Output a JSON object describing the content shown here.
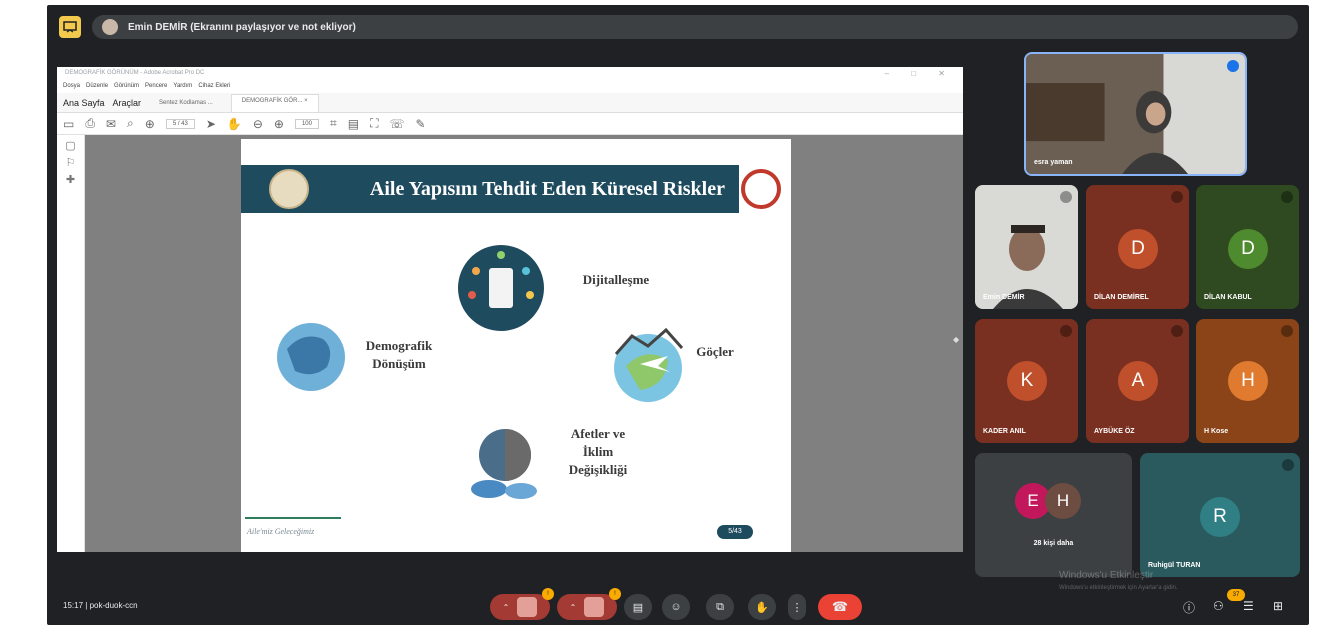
{
  "banner": {
    "presenter_text": "Emin DEMİR (Ekranını paylaşıyor ve not ekliyor)"
  },
  "pdf": {
    "titlebar": "DEMOGRAFİK GÖRÜNÜM - Adobe Acrobat Pro DC",
    "menu": [
      "Dosya",
      "Düzenle",
      "Görünüm",
      "Pencere",
      "Yardım",
      "Cihaz Ekleri"
    ],
    "nav_home": "Ana Sayfa",
    "nav_tools": "Araçlar",
    "tabs": [
      "Sentez Kodlamas ...",
      "DEMOGRAFİK GÖR... ×"
    ],
    "page_box": "5 / 43",
    "zoom": "100"
  },
  "slide": {
    "title": "Aile Yapısını Tehdit Eden Küresel Riskler",
    "items": {
      "dijital": "Dijitalleşme",
      "demografik": "Demografik\nDönüşüm",
      "gocler": "Göçler",
      "afetler": "Afetler ve\nİklim\nDeğişikliği"
    },
    "footer": "Aile'miz Geleceğimiz",
    "page": "5/43"
  },
  "participants": {
    "self": {
      "name": "esra yaman"
    },
    "emin": {
      "name": "Emin DEMİR"
    },
    "dilan_demirel": {
      "name": "DİLAN DEMİREL",
      "initial": "D",
      "color": "#b5472a"
    },
    "dilan_kabul": {
      "name": "DİLAN KABUL",
      "initial": "D",
      "color": "#3a6b2e"
    },
    "kader": {
      "name": "KADER ANIL",
      "initial": "K",
      "color": "#b5472a"
    },
    "aybuke": {
      "name": "AYBÜKE ÖZ",
      "initial": "A",
      "color": "#b5472a"
    },
    "hkose": {
      "name": "H Kose",
      "initial": "H",
      "color": "#c76a2a"
    },
    "more": {
      "label": "28 kişi daha",
      "initial_e": "E",
      "initial_h": "H"
    },
    "ruhigul": {
      "name": "Ruhigül TURAN",
      "initial": "R",
      "color": "#2e6e6e"
    }
  },
  "bottom": {
    "time": "15:17",
    "meeting_code": "pok-duok-ccn",
    "separator": "|",
    "people_count": "37"
  },
  "watermark": {
    "line1": "Windows'u Etkinleştir",
    "line2": "Windows'u etkinleştirmek için Ayarlar'a gidin."
  }
}
